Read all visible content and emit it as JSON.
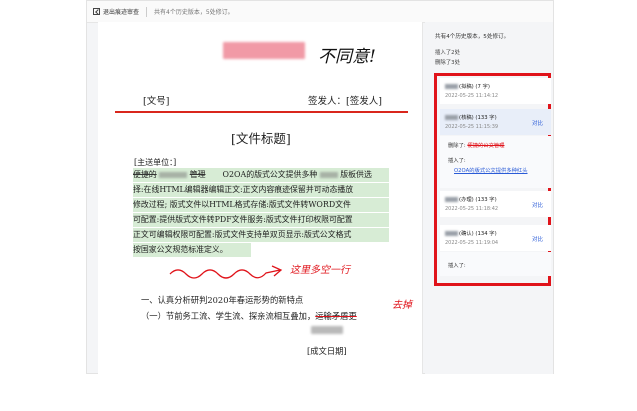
{
  "toolbar": {
    "exit_label": "退出痕迹审查",
    "summary": "共有4个历史版本，5处修订。"
  },
  "document": {
    "doc_number": "[文号]",
    "signer": "签发人：[签发人]",
    "title": "[文件标题]",
    "recipient": "[主送单位：]",
    "para_line1_prefix": "便捷的",
    "para_line1_mid": "管理",
    "para_line1_rest": "O2OA的版式公文提供多种",
    "para_line1_end": "版板供选",
    "para_lines": [
      "择:在线HTML编辑器编辑正文:正文内容痕迹保留并可动态播放",
      "修改过程;  版式文件以HTML格式存储:版式文件转WORD文件",
      "可配置:提供版式文件转PDF文件服务:版式文件打印权限可配置",
      "正文可编辑权限可配置:版式文件支持单双页显示:版式公文格式",
      "按国家公文规范标准定义。"
    ],
    "section1": "一、认真分析研判2020年春运形势的新特点",
    "section1_1_kept": "（一）节前务工流、学生流、探亲流相互叠加，",
    "section1_1_struck": "运输矛盾更",
    "date": "[成文日期]"
  },
  "annotations": {
    "top_note": "不同意!",
    "add_line_note": "这里多空一行",
    "delete_note": "去掉"
  },
  "panel": {
    "summary": "共有4个历史版本，5处修订。",
    "insert_count": "插入了2处",
    "delete_count": "删除了3处",
    "cards": [
      {
        "who": "(拟稿) (7 字)",
        "time": "2022-05-25 11:14:12"
      },
      {
        "who": "(核稿) (133 字)",
        "time": "2022-05-25 11:15:39",
        "compare": "对比",
        "deleted_label": "删除了:",
        "deleted_text": "便捷的公文管理",
        "inserted_label": "插入了:",
        "inserted_text": "O2OA的版式公文提供多种红头"
      },
      {
        "who": "(办理) (133 字)",
        "time": "2022-05-25 11:18:42",
        "compare": "对比"
      },
      {
        "who": "(确认) (134 字)",
        "time": "2022-05-25 11:19:04",
        "compare": "对比",
        "inserted_label": "插入了:"
      }
    ]
  },
  "colors": {
    "accent_red": "#e0131a",
    "link_blue": "#2a5bd7",
    "highlight_green": "#d7ecd5"
  }
}
